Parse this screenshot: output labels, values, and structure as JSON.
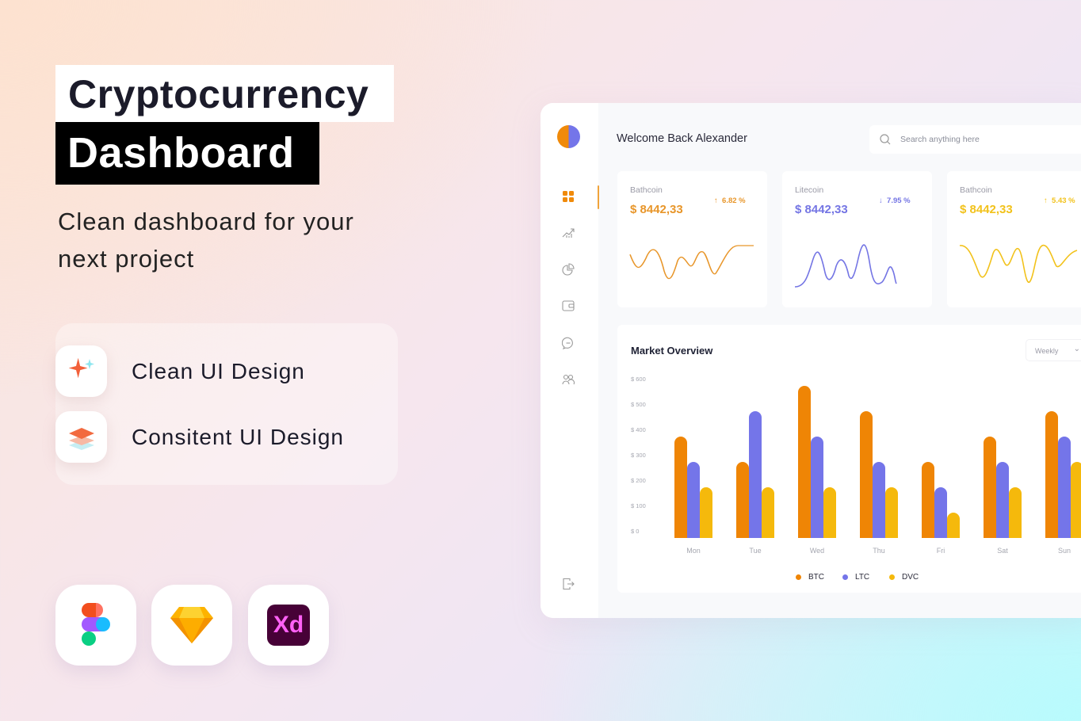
{
  "hero": {
    "title_line1": "Cryptocurrency",
    "title_line2": "Dashboard",
    "subtitle": "Clean dashboard for your next project"
  },
  "features": [
    {
      "icon": "sparkle-icon",
      "label": "Clean UI Design"
    },
    {
      "icon": "layers-icon",
      "label": "Consitent UI Design"
    }
  ],
  "tools": [
    {
      "icon": "figma-logo-icon"
    },
    {
      "icon": "sketch-logo-icon"
    },
    {
      "icon": "adobe-xd-logo-icon",
      "logo_text": "Xd"
    }
  ],
  "dashboard": {
    "header": {
      "welcome": "Welcome Back Alexander",
      "search_placeholder": "Search anything here"
    },
    "sidebar": {
      "items": [
        {
          "icon": "dashboard-grid-icon",
          "active": true
        },
        {
          "icon": "trend-chart-icon"
        },
        {
          "icon": "pie-chart-icon"
        },
        {
          "icon": "wallet-icon"
        },
        {
          "icon": "chat-icon"
        },
        {
          "icon": "users-icon"
        }
      ],
      "logout_icon": "logout-icon"
    },
    "cards": [
      {
        "name": "Bathcoin",
        "price": "$ 8442,33",
        "change": "6.82 %",
        "direction": "up",
        "arrow": "↑",
        "color": "#e8962a"
      },
      {
        "name": "Litecoin",
        "price": "$ 8442,33",
        "change": "7.95 %",
        "direction": "down",
        "arrow": "↓",
        "color": "#7475e4"
      },
      {
        "name": "Bathcoin",
        "price": "$ 8442,33",
        "change": "5.43 %",
        "direction": "up",
        "arrow": "↑",
        "color": "#f2c21b"
      }
    ],
    "market": {
      "title": "Market Overview",
      "period": "Weekly"
    }
  },
  "chart_data": {
    "type": "bar",
    "title": "Market Overview",
    "categories": [
      "Mon",
      "Tue",
      "Wed",
      "Thu",
      "Fri",
      "Sat",
      "Sun"
    ],
    "y_ticks": [
      "$ 600",
      "$ 500",
      "$ 400",
      "$ 300",
      "$ 200",
      "$ 100",
      "$ 0"
    ],
    "ylim": [
      0,
      600
    ],
    "grid": false,
    "legend_position": "bottom",
    "series": [
      {
        "name": "BTC",
        "color": "#ef8505",
        "values": [
          400,
          300,
          600,
          500,
          300,
          400,
          500
        ]
      },
      {
        "name": "LTC",
        "color": "#7475e9",
        "values": [
          300,
          500,
          400,
          300,
          200,
          300,
          400
        ]
      },
      {
        "name": "DVC",
        "color": "#f5b90c",
        "values": [
          200,
          200,
          200,
          200,
          100,
          200,
          300
        ]
      }
    ]
  }
}
